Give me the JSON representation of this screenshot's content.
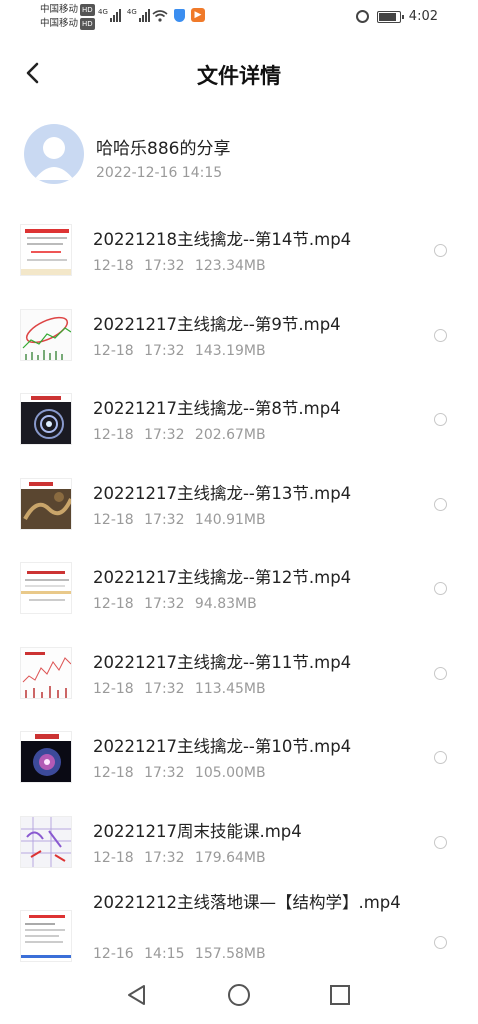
{
  "status_bar": {
    "carrier1": "中国移动",
    "carrier2": "中国移动",
    "hd": "HD",
    "net1": "4G",
    "net2": "4G",
    "time": "4:02",
    "battery_level": 0.78
  },
  "header": {
    "title": "文件详情",
    "back_icon": "chevron-left-icon"
  },
  "sharer": {
    "name": "哈哈乐886的分享",
    "time": "2022-12-16  14:15"
  },
  "files": [
    {
      "name": "20221218主线擒龙--第14节.mp4",
      "meta": "12-18  17:32  123.34MB"
    },
    {
      "name": "20221217主线擒龙--第9节.mp4",
      "meta": "12-18  17:32  143.19MB"
    },
    {
      "name": "20221217主线擒龙--第8节.mp4",
      "meta": "12-18  17:32  202.67MB"
    },
    {
      "name": "20221217主线擒龙--第13节.mp4",
      "meta": "12-18  17:32  140.91MB"
    },
    {
      "name": "20221217主线擒龙--第12节.mp4",
      "meta": "12-18  17:32  94.83MB"
    },
    {
      "name": "20221217主线擒龙--第11节.mp4",
      "meta": "12-18  17:32  113.45MB"
    },
    {
      "name": "20221217主线擒龙--第10节.mp4",
      "meta": "12-18  17:32  105.00MB"
    },
    {
      "name": "20221217周末技能课.mp4",
      "meta": "12-18  17:32  179.64MB"
    },
    {
      "name": "20221212主线落地课—【结构学】.mp4",
      "meta": "12-16  14:15  157.58MB"
    }
  ],
  "colors": {
    "meta_gray": "#9a9a9a",
    "avatar_bg": "#c9d9f2"
  }
}
